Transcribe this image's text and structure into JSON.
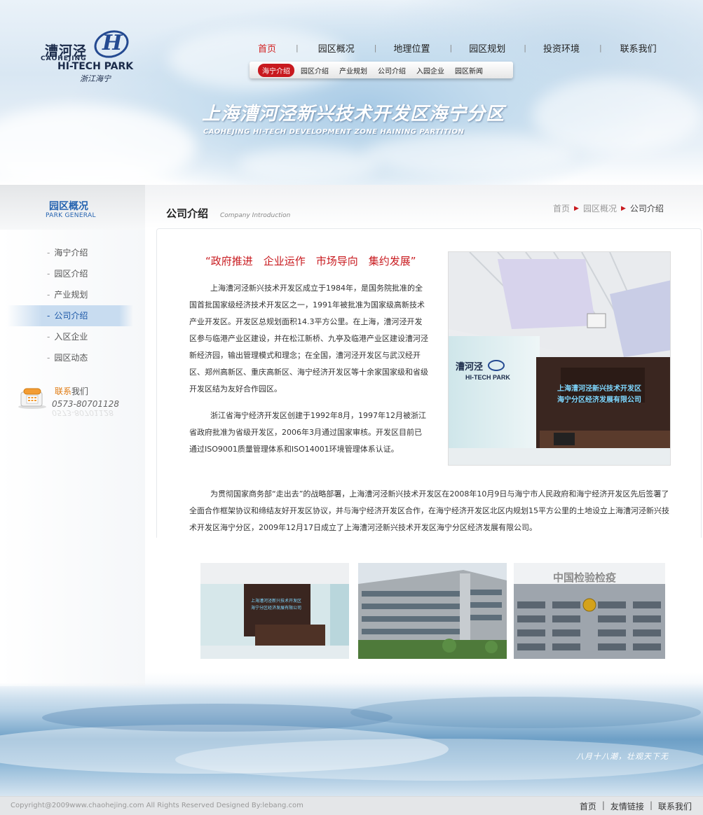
{
  "logo": {
    "cn": "漕河泾",
    "mark": "H",
    "en_line1": "CAOHEJING",
    "en_line2": "HI-TECH PARK",
    "signature": "浙江海宁"
  },
  "nav": {
    "main": [
      "首页",
      "园区概况",
      "地理位置",
      "园区规划",
      "投资环境",
      "联系我们"
    ],
    "main_active": "首页",
    "sub": [
      "海宁介绍",
      "园区介绍",
      "产业规划",
      "公司介绍",
      "入园企业",
      "园区新闻"
    ],
    "sub_active": "海宁介绍"
  },
  "banner": {
    "title_cn": "上海漕河泾新兴技术开发区海宁分区",
    "title_en": "CAOHEJING HI-TECH DEVELOPMENT ZONE HAINING PARTITION"
  },
  "sidebar": {
    "title": "园区概况",
    "subtitle": "PARK GENERAL",
    "items": [
      "海宁介绍",
      "园区介绍",
      "产业规划",
      "公司介绍",
      "入区企业",
      "园区动态"
    ],
    "active": "公司介绍",
    "contact_label_hl": "联系",
    "contact_label": "我们",
    "phone": "0573-80701128"
  },
  "content": {
    "title": "公司介绍",
    "subtitle": "Company Introduction",
    "breadcrumb": [
      "首页",
      "园区概况",
      "公司介绍"
    ],
    "slogan": "“政府推进　企业运作　市场导向　集约发展”",
    "para1": "上海漕河泾新兴技术开发区成立于1984年，是国务院批准的全国首批国家级经济技术开发区之一，1991年被批准为国家级高新技术产业开发区。开发区总规划面积14.3平方公里。在上海，漕河泾开发区参与临港产业区建设，并在松江新桥、九亭及临港产业区建设漕河泾新经济园，输出管理模式和理念；在全国，漕河泾开发区与武汉经开区、郑州高新区、重庆高新区、海宁经济开发区等十余家国家级和省级开发区结为友好合作园区。",
    "para2": "浙江省海宁经济开发区创建于1992年8月，1997年12月被浙江省政府批准为省级开发区，2006年3月通过国家审核。开发区目前已通过ISO9001质量管理体系和ISO14001环境管理体系认证。",
    "para3": "为贯彻国家商务部“走出去”的战略部署，上海漕河泾新兴技术开发区在2008年10月9日与海宁市人民政府和海宁经济开发区先后签署了全面合作框架协议和缔结友好开发区协议，并与海宁经济开发区合作，在海宁经济开发区北区内规划15平方公里的土地设立上海漕河泾新兴技术开发区海宁分区，2009年12月17日成立了上海漕河泾新兴技术开发区海宁分区经济发展有限公司。",
    "photo_logo_cn": "漕河泾",
    "photo_logo_en": "HI-TECH PARK",
    "photo_sign_line1": "上海漕河泾新兴技术开发区",
    "photo_sign_line2": "海宁分区经济发展有限公司",
    "thumb3_sign": "中国检验检疫"
  },
  "ocean_caption": "八月十八潮，壮观天下无",
  "footer": {
    "copyright": "Copyright@2009www.chaohejing.com All Rights Reserved  Designed By:lebang.com",
    "links": [
      "首页",
      "友情链接",
      "联系我们"
    ]
  },
  "colors": {
    "accent_red": "#c8191e",
    "brand_blue": "#244a91",
    "sidebar_blue": "#2563b0"
  }
}
